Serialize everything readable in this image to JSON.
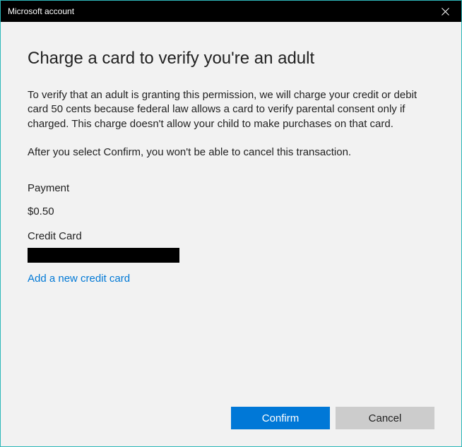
{
  "titlebar": {
    "title": "Microsoft account"
  },
  "main": {
    "heading": "Charge a card to verify you're an adult",
    "description": "To verify that an adult is granting this permission, we will charge your credit or debit card 50 cents because federal law allows a card to verify parental consent only if charged. This charge doesn't allow your child to make purchases on that card.",
    "instruction": "After you select Confirm, you won't be able to cancel this transaction.",
    "payment_label": "Payment",
    "amount": "$0.50",
    "card_label": "Credit Card",
    "card_number": "████████████████",
    "add_card_link": "Add a new credit card"
  },
  "buttons": {
    "confirm": "Confirm",
    "cancel": "Cancel"
  }
}
